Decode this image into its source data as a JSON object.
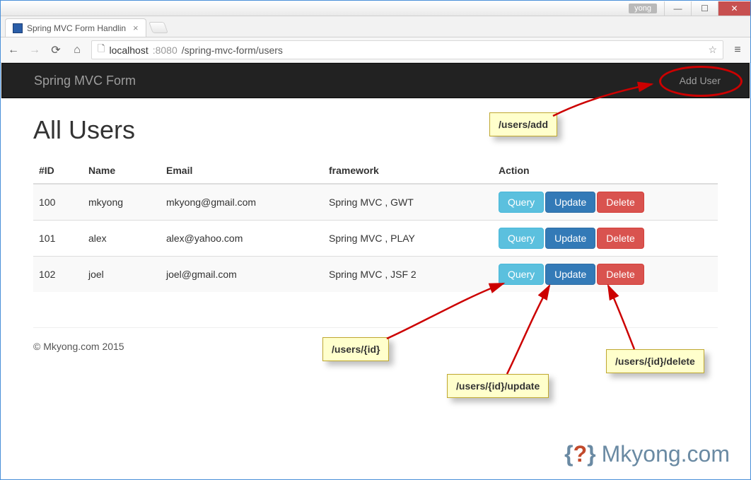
{
  "titlebar": {
    "user_badge": "yong"
  },
  "tab": {
    "title": "Spring MVC Form Handlin"
  },
  "url": {
    "scheme_host_pre": "localhost",
    "port_dim": ":8080",
    "path": "/spring-mvc-form/users"
  },
  "navbar": {
    "brand": "Spring MVC Form",
    "add_user": "Add User"
  },
  "page": {
    "heading": "All Users"
  },
  "table": {
    "headers": {
      "id": "#ID",
      "name": "Name",
      "email": "Email",
      "framework": "framework",
      "action": "Action"
    },
    "rows": [
      {
        "id": "100",
        "name": "mkyong",
        "email": "mkyong@gmail.com",
        "framework": "Spring MVC , GWT"
      },
      {
        "id": "101",
        "name": "alex",
        "email": "alex@yahoo.com",
        "framework": "Spring MVC , PLAY"
      },
      {
        "id": "102",
        "name": "joel",
        "email": "joel@gmail.com",
        "framework": "Spring MVC , JSF 2"
      }
    ],
    "buttons": {
      "query": "Query",
      "update": "Update",
      "delete": "Delete"
    }
  },
  "footer": {
    "copyright": "© Mkyong.com 2015"
  },
  "annotations": {
    "add_user": "/users/add",
    "query": "/users/{id}",
    "update": "/users/{id}/update",
    "delete": "/users/{id}/delete"
  },
  "watermark": {
    "text1": "Mkyong",
    "text2": ".com"
  }
}
